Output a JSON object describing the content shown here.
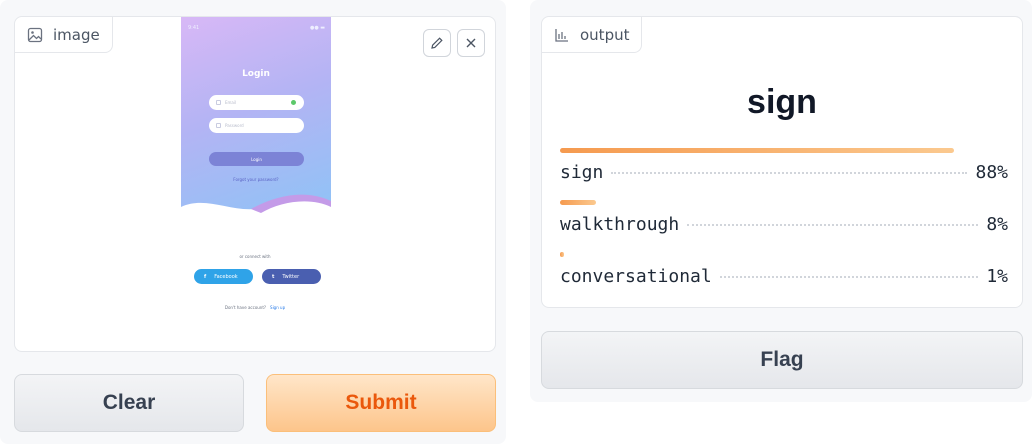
{
  "input": {
    "tag_label": "image",
    "tag_icon": "image-icon",
    "tools": [
      "edit-icon",
      "close-icon"
    ],
    "mockup": {
      "status_time": "9:41",
      "status_right": "●● ▬",
      "title": "Login",
      "email_placeholder": "Email",
      "password_placeholder": "Password",
      "login_button": "Login",
      "forgot": "Forgot your password?",
      "connect_with": "or connect with",
      "facebook": "Facebook",
      "twitter": "Twitter",
      "no_account": "Don't have account?",
      "signup": "Sign up"
    }
  },
  "buttons": {
    "clear": "Clear",
    "submit": "Submit",
    "flag": "Flag"
  },
  "output": {
    "tag_label": "output",
    "tag_icon": "bar-chart-icon",
    "top_label": "sign",
    "confidences": [
      {
        "label": "sign",
        "value": "88%",
        "fraction": 0.88
      },
      {
        "label": "walkthrough",
        "value": "8%",
        "fraction": 0.08
      },
      {
        "label": "conversational",
        "value": "1%",
        "fraction": 0.01
      }
    ]
  },
  "colors": {
    "accent": "#ea580c",
    "bar_start": "#f59a4f",
    "bar_end": "#fbc98f",
    "phone_gradient_top": "#d8b8f6",
    "phone_gradient_bottom": "#8cc4f6",
    "facebook": "#2fa3e8",
    "twitter": "#4a5fb0"
  }
}
